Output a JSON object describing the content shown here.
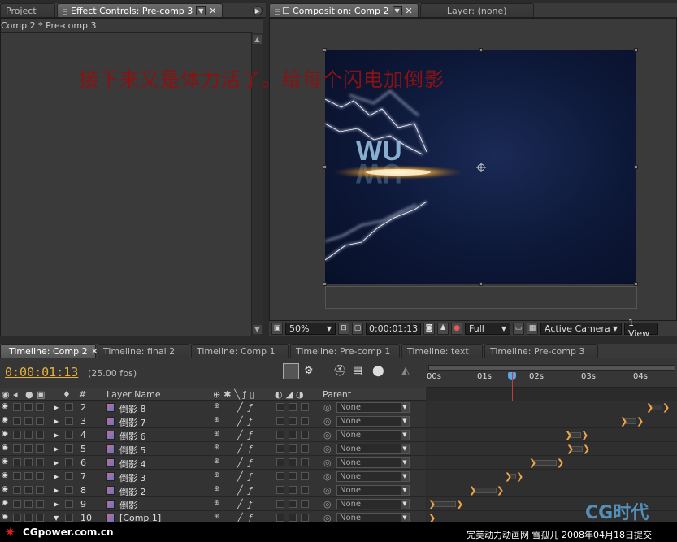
{
  "top_left_tabs": {
    "project": "Project",
    "effect_controls": "Effect Controls: Pre-comp 3"
  },
  "effect_breadcrumb": "Comp 2 * Pre-comp 3",
  "viewer_tabs": {
    "composition": "Composition: Comp 2",
    "layer": "Layer: (none)"
  },
  "overlay_caption": "接下来又是体力活了。给每个闪电加倒影",
  "viewer_toolbar": {
    "zoom": "50%",
    "timecode": "0:00:01:13",
    "resolution": "Full",
    "camera": "Active Camera",
    "view": "1 View"
  },
  "timeline_tabs": [
    "Timeline: Comp 2",
    "Timeline: final 2",
    "Timeline: Comp 1",
    "Timeline: Pre-comp 1",
    "Timeline: text",
    "Timeline: Pre-comp 3"
  ],
  "timeline": {
    "current_time": "0:00:01:13",
    "fps": "(25.00 fps)",
    "col_number": "#",
    "col_layer_name": "Layer Name",
    "col_parent": "Parent",
    "ruler": [
      "00s",
      "01s",
      "02s",
      "03s",
      "04s"
    ]
  },
  "layers": [
    {
      "num": "2",
      "name": "倒影 8",
      "parent": "None"
    },
    {
      "num": "3",
      "name": "倒影 7",
      "parent": "None"
    },
    {
      "num": "4",
      "name": "倒影 6",
      "parent": "None"
    },
    {
      "num": "5",
      "name": "倒影 5",
      "parent": "None"
    },
    {
      "num": "6",
      "name": "倒影 4",
      "parent": "None"
    },
    {
      "num": "7",
      "name": "倒影 3",
      "parent": "None"
    },
    {
      "num": "8",
      "name": "倒影 2",
      "parent": "None"
    },
    {
      "num": "9",
      "name": "倒影",
      "parent": "None"
    },
    {
      "num": "10",
      "name": "[Comp 1]",
      "parent": "None"
    }
  ],
  "footer": {
    "site": "CGpower.com.cn",
    "credit": "完美动力动画网 雪孤儿 2008年04月18日提交",
    "logo": "CG时代"
  }
}
